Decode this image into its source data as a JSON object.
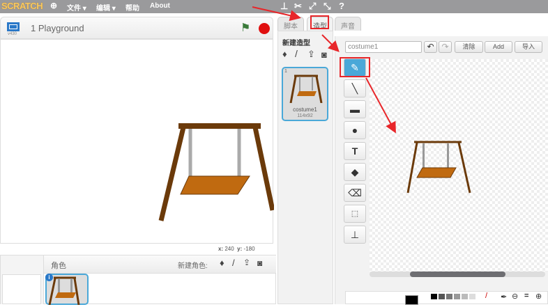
{
  "topbar": {
    "logo": "SCRATCH",
    "menus": [
      "文件 ▾",
      "编辑 ▾",
      "帮助",
      "About"
    ]
  },
  "stage": {
    "version": "v430",
    "title": "1 Playground",
    "x_label": "x:",
    "x_value": "240",
    "y_label": "y:",
    "y_value": "-180"
  },
  "sprites": {
    "header": "角色",
    "new_sprite_label": "新建角色:"
  },
  "tabs": [
    "脚本",
    "造型",
    "声音"
  ],
  "costumes": {
    "new_costume_label": "新建造型",
    "items": [
      {
        "index": "1",
        "name": "costume1",
        "size": "114x92"
      }
    ]
  },
  "editor": {
    "costume_name": "costume1",
    "clear": "清除",
    "add": "Add",
    "import": "导入"
  },
  "colors": {
    "accent": "#4aa8d8",
    "highlight": "#e8262a"
  }
}
